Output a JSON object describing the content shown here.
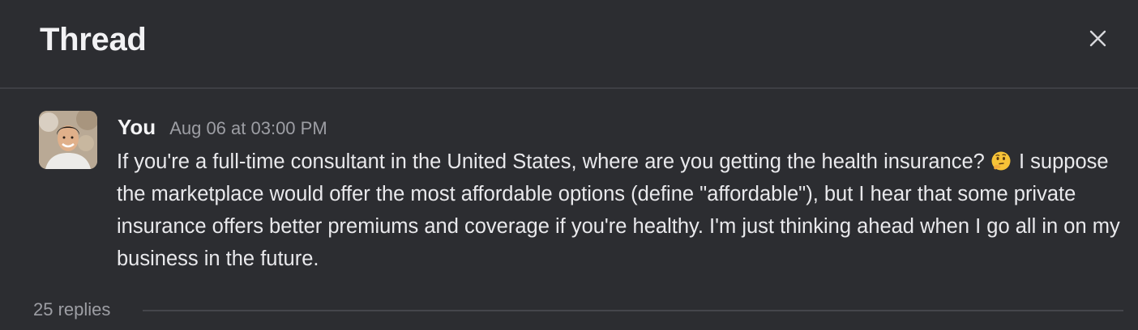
{
  "header": {
    "title": "Thread",
    "close_icon": "close-icon"
  },
  "message": {
    "author": "You",
    "timestamp": "Aug 06 at 03:00 PM",
    "avatar_icon": "avatar",
    "line1": "If you're a full-time consultant in the United States, where are you getting the health insurance?",
    "emoji": "thinking-face-emoji",
    "line2": " I suppose the marketplace would offer the most affordable options (define \"affordable\"), but I hear that some private insurance offers better premiums and coverage if you're healthy. I'm just thinking ahead when I go all in on my business in the future."
  },
  "footer": {
    "replies_label": "25 replies"
  },
  "colors": {
    "background": "#2c2d31",
    "divider": "#3e3f44",
    "muted_text": "#9d9ea4",
    "primary_text": "#ececee"
  }
}
